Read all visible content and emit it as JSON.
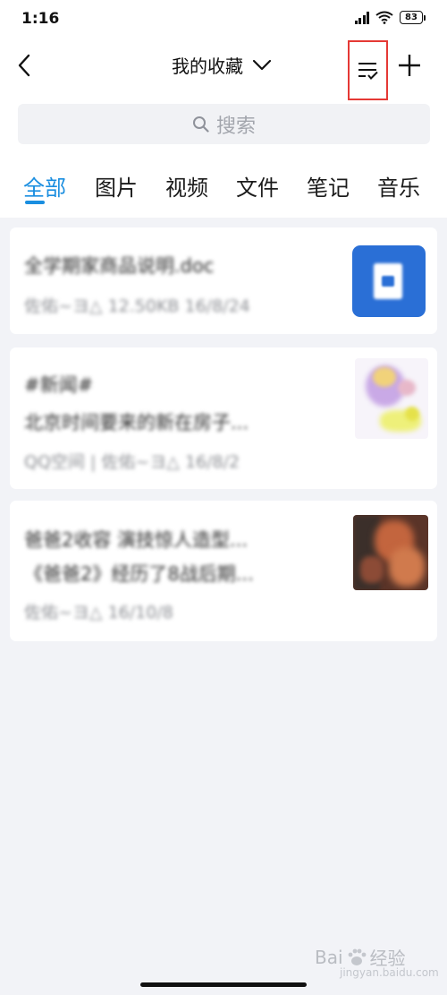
{
  "status_bar": {
    "time": "1:16",
    "battery": "83"
  },
  "header": {
    "title": "我的收藏"
  },
  "search": {
    "placeholder": "搜索"
  },
  "tabs": [
    "全部",
    "图片",
    "视频",
    "文件",
    "笔记",
    "音乐"
  ],
  "active_tab": "全部",
  "items": [
    {
      "title": "全学期家商品说明.doc",
      "meta": "佐佑~ヨ△  12.50KB  16/8/24",
      "thumb": "word-document-icon"
    },
    {
      "title": "#新闻#",
      "subtitle": "北京时间要来的新在房子...",
      "meta": "QQ空间 | 佐佑~ヨ△  16/8/2",
      "thumb": "cartoon-image"
    },
    {
      "title": "爸爸2收容 演技惊人造型...",
      "subtitle": "《爸爸2》经历了8战后期...",
      "meta": "佐佑~ヨ△  16/10/8",
      "thumb": "photo-image"
    }
  ],
  "watermark": {
    "brand": "Bai",
    "suffix": "经验",
    "sub": "jingyan.baidu.com"
  },
  "colors": {
    "accent": "#1a8ee0",
    "highlight_box": "#e53935",
    "background": "#f2f3f7"
  }
}
